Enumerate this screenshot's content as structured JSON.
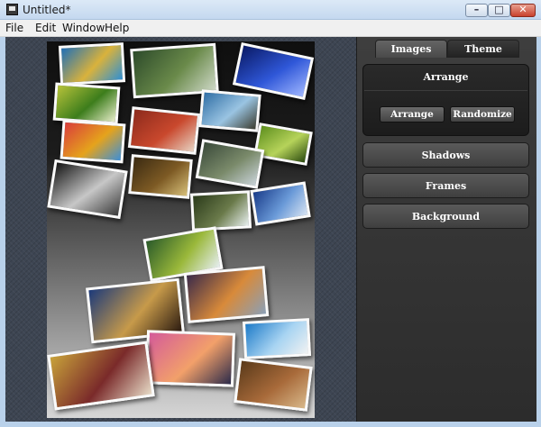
{
  "window": {
    "title": "Untitled*",
    "controls": {
      "minimize": "–",
      "maximize": "□",
      "close": "✕"
    }
  },
  "menu": {
    "items": [
      "File",
      "Edit",
      "Window",
      "Help"
    ]
  },
  "panel": {
    "tabs": [
      {
        "label": "Images"
      },
      {
        "label": "Theme"
      }
    ],
    "arrange": {
      "title": "Arrange",
      "arrange_button": "Arrange",
      "randomize_button": "Randomize"
    },
    "sections": [
      "Shadows",
      "Frames",
      "Background"
    ]
  },
  "collage": {
    "photos": [
      {
        "name": "photo-swimmers",
        "colors": [
          "#1f6fb8",
          "#d9b23c",
          "#2d8fd5"
        ]
      },
      {
        "name": "photo-waterfalls",
        "colors": [
          "#2c4a2a",
          "#6a8a4a",
          "#cfd9c8"
        ]
      },
      {
        "name": "photo-blue-lights",
        "colors": [
          "#0a1a66",
          "#2f57d8",
          "#9fb6ff"
        ]
      },
      {
        "name": "photo-birds-green",
        "colors": [
          "#b7c23a",
          "#3d7d1c",
          "#e9eecb"
        ]
      },
      {
        "name": "photo-track-runner",
        "colors": [
          "#8c2a1c",
          "#c9482d",
          "#e7d4c4"
        ]
      },
      {
        "name": "photo-coast",
        "colors": [
          "#2f6ea5",
          "#9ac4e2",
          "#3b3b2e"
        ]
      },
      {
        "name": "photo-colored-pencils",
        "colors": [
          "#d93c3c",
          "#e5a31c",
          "#3c8fd9"
        ]
      },
      {
        "name": "photo-green-leaves",
        "colors": [
          "#5e8f1e",
          "#b6d35a",
          "#2b4a10"
        ]
      },
      {
        "name": "photo-cave",
        "colors": [
          "#3a2a12",
          "#7d5a24",
          "#d7c07a"
        ]
      },
      {
        "name": "photo-rocks",
        "colors": [
          "#3a4a3a",
          "#7a8a6a",
          "#c9d3d9"
        ]
      },
      {
        "name": "photo-robots",
        "colors": [
          "#141414",
          "#c7c7c7",
          "#3a3a3a"
        ]
      },
      {
        "name": "photo-waterfall-rock",
        "colors": [
          "#2a3a1a",
          "#6a7a4a",
          "#e8f0f0"
        ]
      },
      {
        "name": "photo-harbor",
        "colors": [
          "#1a3c8a",
          "#6a9ad8",
          "#d8e4f2"
        ]
      },
      {
        "name": "photo-parrot",
        "colors": [
          "#2a5a2a",
          "#9ab83a",
          "#e6eef2"
        ]
      },
      {
        "name": "photo-temple",
        "colors": [
          "#1c3a7a",
          "#c79a4a",
          "#2a1a10"
        ]
      },
      {
        "name": "photo-lake-sunset",
        "colors": [
          "#3a2a4a",
          "#d88a3a",
          "#8aa0b8"
        ]
      },
      {
        "name": "photo-pink-sky",
        "colors": [
          "#d45a9a",
          "#f2a06a",
          "#2a2a4a"
        ]
      },
      {
        "name": "photo-birds-on-wire",
        "colors": [
          "#1c7ac8",
          "#a8d4f2",
          "#f2f2f2"
        ]
      },
      {
        "name": "photo-dancers",
        "colors": [
          "#c8a23a",
          "#7a2a2a",
          "#e8dcc8"
        ]
      },
      {
        "name": "photo-crowd",
        "colors": [
          "#5a3a1a",
          "#a86a3a",
          "#d8b88a"
        ]
      }
    ]
  }
}
